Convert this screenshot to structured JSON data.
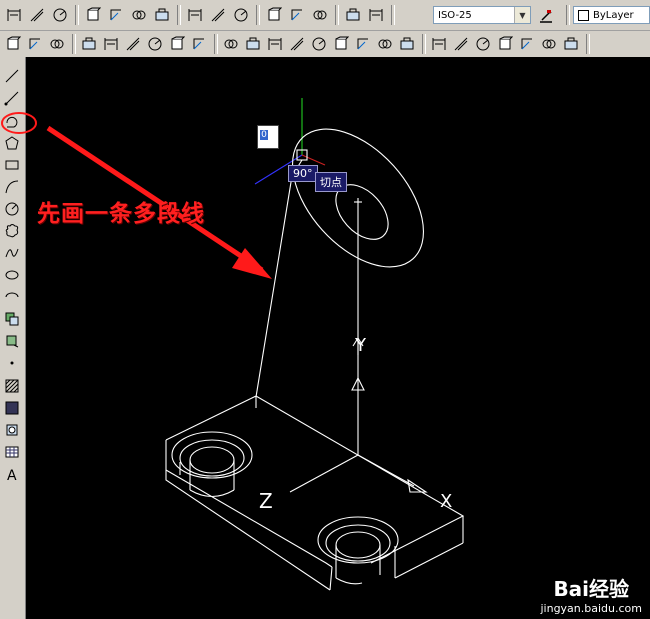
{
  "toolbar_top": {
    "dim_style_value": "ISO-25",
    "layer_value": "ByLayer"
  },
  "canvas": {
    "tooltip_angle": "90°",
    "tooltip_snap": "切点",
    "input_value": "0",
    "axis_label_y": "Y",
    "axis_label_z": "Z",
    "axis_label_x": "X",
    "annotation_text": "先画一条多段线",
    "watermark_brand": "Bai经验",
    "watermark_url": "jingyan.baidu.com",
    "annotation_color": "#ff2020",
    "background_color": "#000000"
  },
  "icons_top_row1": [
    "dim-linear-icon",
    "dim-aligned-icon",
    "dim-arc-icon",
    "dim-ordinate-icon",
    "dim-radius-icon",
    "dim-jogged-icon",
    "dim-diameter-icon",
    "dim-angular-icon",
    "quick-dim-icon",
    "dim-baseline-icon",
    "dim-continue-icon",
    "leader-icon",
    "tolerance-icon",
    "center-mark-icon",
    "dim-edit-icon",
    "dim-text-edit-icon",
    "dim-update-icon",
    "dim-style-icon"
  ],
  "icons_top_row2": [
    "union-icon",
    "subtract-icon",
    "intersect-icon",
    "box-icon",
    "wedge-icon",
    "cylinder-icon",
    "cone-icon",
    "sphere-icon",
    "torus-icon",
    "extrude-icon",
    "revolve-icon",
    "slice-icon",
    "section-icon",
    "interfere-icon",
    "imprint-icon",
    "separate-icon",
    "clean-icon",
    "shell-icon",
    "check-icon",
    "ucs-icon",
    "ucs-world-icon",
    "ucs-prev-icon",
    "ucs-face-icon",
    "ucs-object-icon",
    "ucs-view-icon"
  ],
  "icons_left": [
    "line-icon",
    "construction-line-icon",
    "polyline-icon",
    "polygon-icon",
    "rectangle-icon",
    "arc-icon",
    "circle-icon",
    "revision-cloud-icon",
    "spline-icon",
    "ellipse-icon",
    "ellipse-arc-icon",
    "insert-block-icon",
    "make-block-icon",
    "point-icon",
    "hatch-icon",
    "gradient-icon",
    "region-icon",
    "table-icon",
    "multiline-text-icon"
  ]
}
